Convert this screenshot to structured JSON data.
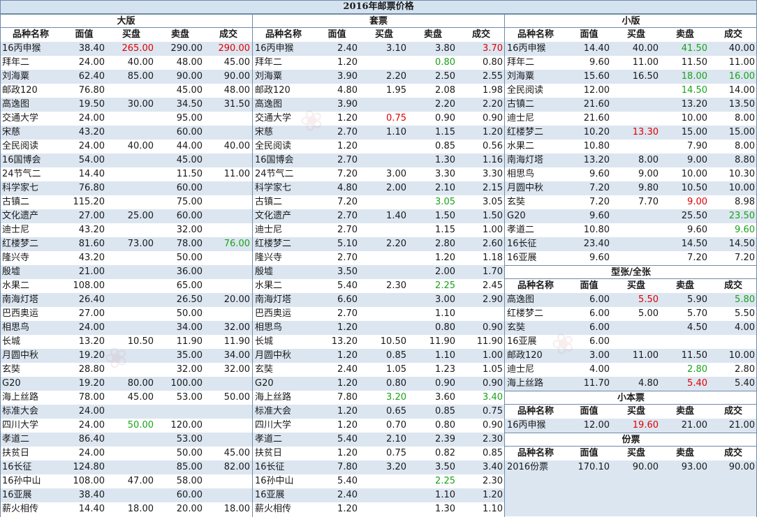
{
  "title": "2016年邮票价格",
  "headers": [
    "品种名称",
    "面值",
    "买盘",
    "卖盘",
    "成交"
  ],
  "colors": {
    "red": "#e10000",
    "green": "#1aa31a",
    "band": "#dce6f1"
  },
  "large": {
    "label": "大版",
    "rows": [
      [
        "16丙申猴",
        "38.40",
        {
          "v": "265.00",
          "c": "red"
        },
        "290.00",
        {
          "v": "290.00",
          "c": "red"
        }
      ],
      [
        "拜年二",
        "24.00",
        "40.00",
        "48.00",
        "45.00"
      ],
      [
        "刘海粟",
        "62.40",
        "85.00",
        "90.00",
        "90.00"
      ],
      [
        "邮政120",
        "76.80",
        "",
        "45.00",
        "48.00"
      ],
      [
        "高逸图",
        "19.50",
        "30.00",
        "34.50",
        "31.50"
      ],
      [
        "交通大学",
        "24.00",
        "",
        "95.00",
        ""
      ],
      [
        "宋慈",
        "43.20",
        "",
        "60.00",
        ""
      ],
      [
        "全民阅读",
        "24.00",
        "40.00",
        "44.00",
        "40.00"
      ],
      [
        "16国博会",
        "54.00",
        "",
        "45.00",
        ""
      ],
      [
        "24节气二",
        "14.40",
        "",
        "11.50",
        "11.00"
      ],
      [
        "科学家七",
        "76.80",
        "",
        "60.00",
        ""
      ],
      [
        "古镇二",
        "115.20",
        "",
        "75.00",
        ""
      ],
      [
        "文化遗产",
        "27.00",
        "25.00",
        "60.00",
        ""
      ],
      [
        "迪士尼",
        "43.20",
        "",
        "32.00",
        ""
      ],
      [
        "红楼梦二",
        "81.60",
        "73.00",
        "78.00",
        {
          "v": "76.00",
          "c": "green"
        }
      ],
      [
        "隆兴寺",
        "43.20",
        "",
        "50.00",
        ""
      ],
      [
        "殷墟",
        "21.00",
        "",
        "36.00",
        ""
      ],
      [
        "水果二",
        "108.00",
        "",
        "65.00",
        ""
      ],
      [
        "南海灯塔",
        "26.40",
        "",
        "26.50",
        "20.00"
      ],
      [
        "巴西奥运",
        "27.00",
        "",
        "50.00",
        ""
      ],
      [
        "相思鸟",
        "24.00",
        "",
        "34.00",
        "32.00"
      ],
      [
        "长城",
        "13.20",
        "10.50",
        "11.90",
        "11.90"
      ],
      [
        "月圆中秋",
        "19.20",
        "",
        "35.00",
        "34.00"
      ],
      [
        "玄奘",
        "28.80",
        "",
        "32.00",
        "32.00"
      ],
      [
        "G20",
        "19.20",
        "80.00",
        "100.00",
        ""
      ],
      [
        "海上丝路",
        "78.00",
        "45.00",
        "53.00",
        "50.00"
      ],
      [
        "标准大会",
        "24.00",
        "",
        "",
        ""
      ],
      [
        "四川大学",
        "24.00",
        {
          "v": "50.00",
          "c": "green"
        },
        "120.00",
        ""
      ],
      [
        "孝道二",
        "86.40",
        "",
        "53.00",
        ""
      ],
      [
        "扶贫日",
        "24.00",
        "",
        "50.00",
        "45.00"
      ],
      [
        "16长征",
        "124.80",
        "",
        "85.00",
        "82.00"
      ],
      [
        "16孙中山",
        "108.00",
        "47.00",
        "58.00",
        ""
      ],
      [
        "16亚展",
        "38.40",
        "",
        "60.00",
        ""
      ],
      [
        "薪火相传",
        "14.40",
        "18.00",
        "20.00",
        "18.00"
      ]
    ]
  },
  "sets": {
    "label": "套票",
    "rows": [
      [
        "16丙申猴",
        "2.40",
        "3.10",
        "3.80",
        {
          "v": "3.70",
          "c": "red"
        }
      ],
      [
        "拜年二",
        "1.20",
        "",
        {
          "v": "0.80",
          "c": "green"
        },
        "0.80"
      ],
      [
        "刘海粟",
        "3.90",
        "2.20",
        "2.50",
        "2.55"
      ],
      [
        "邮政120",
        "4.80",
        "1.95",
        "2.08",
        "1.98"
      ],
      [
        "高逸图",
        "3.90",
        "",
        "2.20",
        "2.20"
      ],
      [
        "交通大学",
        "1.20",
        {
          "v": "0.75",
          "c": "red"
        },
        "0.90",
        "0.90"
      ],
      [
        "宋慈",
        "2.70",
        "1.10",
        "1.15",
        "1.20"
      ],
      [
        "全民阅读",
        "1.20",
        "",
        "0.85",
        "0.56"
      ],
      [
        "16国博会",
        "2.70",
        "",
        "1.30",
        "1.16"
      ],
      [
        "24节气二",
        "7.20",
        "3.00",
        "3.30",
        "3.30"
      ],
      [
        "科学家七",
        "4.80",
        "2.00",
        "2.10",
        "2.15"
      ],
      [
        "古镇二",
        "7.20",
        "",
        {
          "v": "3.05",
          "c": "green"
        },
        "3.05"
      ],
      [
        "文化遗产",
        "2.70",
        "1.40",
        "1.50",
        "1.50"
      ],
      [
        "迪士尼",
        "2.70",
        "",
        "1.15",
        "1.00"
      ],
      [
        "红楼梦二",
        "5.10",
        "2.20",
        "2.80",
        "2.60"
      ],
      [
        "隆兴寺",
        "2.70",
        "",
        "1.20",
        "1.18"
      ],
      [
        "殷墟",
        "3.50",
        "",
        "2.00",
        "1.70"
      ],
      [
        "水果二",
        "5.40",
        "2.30",
        {
          "v": "2.25",
          "c": "green"
        },
        "2.45"
      ],
      [
        "南海灯塔",
        "6.60",
        "",
        "3.00",
        "2.90"
      ],
      [
        "巴西奥运",
        "2.70",
        "",
        "1.10",
        ""
      ],
      [
        "相思鸟",
        "1.20",
        "",
        "0.80",
        "0.90"
      ],
      [
        "长城",
        "13.20",
        "10.50",
        "11.90",
        "11.90"
      ],
      [
        "月圆中秋",
        "1.20",
        "0.85",
        "1.10",
        "1.00"
      ],
      [
        "玄奘",
        "2.40",
        "1.05",
        "1.23",
        "1.05"
      ],
      [
        "G20",
        "1.20",
        "0.80",
        "0.90",
        "0.90"
      ],
      [
        "海上丝路",
        "7.80",
        {
          "v": "3.20",
          "c": "green"
        },
        "3.60",
        {
          "v": "3.40",
          "c": "green"
        }
      ],
      [
        "标准大会",
        "1.20",
        "0.65",
        "0.85",
        "0.75"
      ],
      [
        "四川大学",
        "1.20",
        "0.70",
        "0.80",
        "0.90"
      ],
      [
        "孝道二",
        "5.40",
        "2.10",
        "2.39",
        "2.30"
      ],
      [
        "扶贫日",
        "1.20",
        "0.75",
        "0.82",
        "0.85"
      ],
      [
        "16长征",
        "7.80",
        "3.20",
        "3.50",
        "3.40"
      ],
      [
        "16孙中山",
        "5.40",
        "",
        {
          "v": "2.25",
          "c": "green"
        },
        "2.30"
      ],
      [
        "16亚展",
        "2.40",
        "",
        "1.10",
        "1.20"
      ],
      [
        "薪火相传",
        "1.20",
        "",
        "1.30",
        "1.10"
      ]
    ]
  },
  "small": {
    "label": "小版",
    "rows": [
      [
        "16丙申猴",
        "14.40",
        "40.00",
        {
          "v": "41.50",
          "c": "green"
        },
        "40.00"
      ],
      [
        "拜年二",
        "9.60",
        "11.00",
        "11.50",
        "11.00"
      ],
      [
        "刘海粟",
        "15.60",
        "16.50",
        {
          "v": "18.00",
          "c": "green"
        },
        {
          "v": "16.00",
          "c": "green"
        }
      ],
      [
        "全民阅读",
        "12.00",
        "",
        {
          "v": "14.50",
          "c": "green"
        },
        "14.00"
      ],
      [
        "古镇二",
        "21.60",
        "",
        "13.20",
        "13.50"
      ],
      [
        "迪士尼",
        "21.60",
        "",
        "10.00",
        "8.00"
      ],
      [
        "红楼梦二",
        "10.20",
        {
          "v": "13.30",
          "c": "red"
        },
        "15.00",
        "15.00"
      ],
      [
        "水果二",
        "10.80",
        "",
        "7.90",
        "8.00"
      ],
      [
        "南海灯塔",
        "13.20",
        "8.00",
        "9.00",
        "8.80"
      ],
      [
        "相思鸟",
        "9.60",
        "9.00",
        "10.00",
        "10.30"
      ],
      [
        "月圆中秋",
        "7.20",
        "9.80",
        "10.50",
        "10.00"
      ],
      [
        "玄奘",
        "7.20",
        "7.70",
        {
          "v": "9.00",
          "c": "red"
        },
        "8.98"
      ],
      [
        "G20",
        "9.60",
        "",
        "25.50",
        {
          "v": "23.50",
          "c": "green"
        }
      ],
      [
        "孝道二",
        "10.80",
        "",
        "9.60",
        {
          "v": "9.60",
          "c": "green"
        }
      ],
      [
        "16长征",
        "23.40",
        "",
        "14.50",
        "14.50"
      ],
      [
        "16亚展",
        "9.60",
        "",
        "7.20",
        "7.20"
      ]
    ]
  },
  "sheetlet": {
    "label": "型张/全张",
    "rows": [
      [
        "高逸图",
        "6.00",
        {
          "v": "5.50",
          "c": "red"
        },
        "5.90",
        {
          "v": "5.80",
          "c": "green"
        }
      ],
      [
        "红楼梦二",
        "6.00",
        "5.00",
        "5.70",
        "5.50"
      ],
      [
        "玄奘",
        "6.00",
        "",
        "4.50",
        "4.00"
      ],
      [
        "16亚展",
        "6.00",
        "",
        "",
        ""
      ],
      [
        "邮政120",
        "3.00",
        "11.00",
        "11.50",
        "10.00"
      ],
      [
        "迪士尼",
        "4.00",
        "",
        {
          "v": "2.80",
          "c": "green"
        },
        "2.80"
      ],
      [
        "海上丝路",
        "11.70",
        "4.80",
        {
          "v": "5.40",
          "c": "red"
        },
        "5.40"
      ]
    ]
  },
  "booklet": {
    "label": "小本票",
    "rows": [
      [
        "16丙申猴",
        "12.00",
        {
          "v": "19.60",
          "c": "red"
        },
        "21.00",
        "21.00"
      ]
    ]
  },
  "yearset": {
    "label": "份票",
    "rows": [
      [
        "2016份票",
        "170.10",
        "90.00",
        "93.00",
        "90.00"
      ]
    ]
  }
}
